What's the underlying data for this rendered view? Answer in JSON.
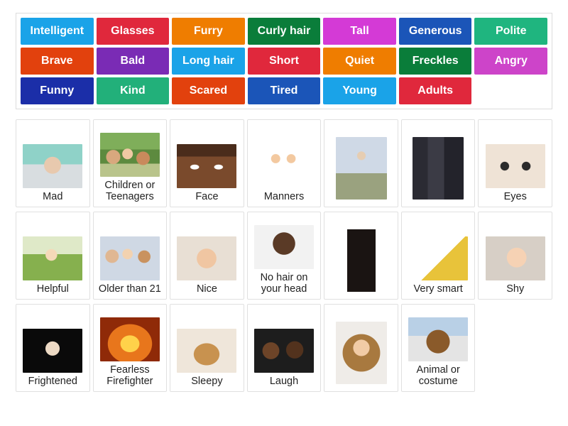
{
  "activity": {
    "type": "match-up-tiles",
    "tiles_rows": [
      [
        {
          "label": "Intelligent",
          "color": "#1aa3e8"
        },
        {
          "label": "Glasses",
          "color": "#e0283c"
        },
        {
          "label": "Furry",
          "color": "#ef7d00"
        },
        {
          "label": "Curly hair",
          "color": "#0a7d3a"
        },
        {
          "label": "Tall",
          "color": "#d43ad6"
        },
        {
          "label": "Generous",
          "color": "#1b55b8"
        },
        {
          "label": "Polite",
          "color": "#1fb57f"
        }
      ],
      [
        {
          "label": "Brave",
          "color": "#e2410d"
        },
        {
          "label": "Bald",
          "color": "#7a2bb5"
        },
        {
          "label": "Long hair",
          "color": "#1aa3e8"
        },
        {
          "label": "Short",
          "color": "#e0283c"
        },
        {
          "label": "Quiet",
          "color": "#ef7d00"
        },
        {
          "label": "Freckles",
          "color": "#0a7d3a"
        },
        {
          "label": "Angry",
          "color": "#cd44c9"
        }
      ],
      [
        {
          "label": "Funny",
          "color": "#1b2ea8"
        },
        {
          "label": "Kind",
          "color": "#22b07a"
        },
        {
          "label": "Scared",
          "color": "#e2410d"
        },
        {
          "label": "Tired",
          "color": "#1b55b8"
        },
        {
          "label": "Young",
          "color": "#1aa3e8"
        },
        {
          "label": "Adults",
          "color": "#e0283c"
        }
      ]
    ],
    "cards_rows": [
      [
        {
          "label": "Mad",
          "image": "boy-in-hoodie-photo",
          "img_class": "im-mad"
        },
        {
          "label": "Children or Teenagers",
          "image": "group-of-kids-photo",
          "img_class": "im-children"
        },
        {
          "label": "Face",
          "image": "close-up-face-photo",
          "img_class": "im-face"
        },
        {
          "label": "Manners",
          "image": "two-children-illustration",
          "img_class": "im-manners"
        },
        {
          "label": "",
          "image": "family-standing-photo",
          "img_class": "im-family tall"
        },
        {
          "label": "",
          "image": "men-in-suits-photo",
          "img_class": "im-suits tall"
        },
        {
          "label": "Eyes",
          "image": "child-with-glasses-photo",
          "img_class": "im-eyes"
        }
      ],
      [
        {
          "label": "Helpful",
          "image": "girl-gardening-photo",
          "img_class": "im-helpful"
        },
        {
          "label": "Older than 21",
          "image": "adults-group-photo",
          "img_class": "im-older"
        },
        {
          "label": "Nice",
          "image": "baby-smiling-photo",
          "img_class": "im-nice"
        },
        {
          "label": "No hair on your head",
          "image": "bald-man-photo",
          "img_class": "im-nohair"
        },
        {
          "label": "",
          "image": "long-black-hair-photo",
          "img_class": "im-longhair tall"
        },
        {
          "label": "Very smart",
          "image": "books-and-papers-photo",
          "img_class": "im-verysmart"
        },
        {
          "label": "Shy",
          "image": "shy-girl-photo",
          "img_class": "im-shy"
        }
      ],
      [
        {
          "label": "Frightened",
          "image": "scared-woman-photo",
          "img_class": "im-frightened"
        },
        {
          "label": "Fearless Firefighter",
          "image": "fire-flames-photo",
          "img_class": "im-fire"
        },
        {
          "label": "Sleepy",
          "image": "sleeping-dog-photo",
          "img_class": "im-sleepy"
        },
        {
          "label": "Laugh",
          "image": "laughing-friends-photo",
          "img_class": "im-laugh"
        },
        {
          "label": "",
          "image": "curly-hair-woman-photo",
          "img_class": "im-curly tall"
        },
        {
          "label": "Animal or costume",
          "image": "dog-in-costume-photo",
          "img_class": "im-animal"
        }
      ]
    ]
  }
}
